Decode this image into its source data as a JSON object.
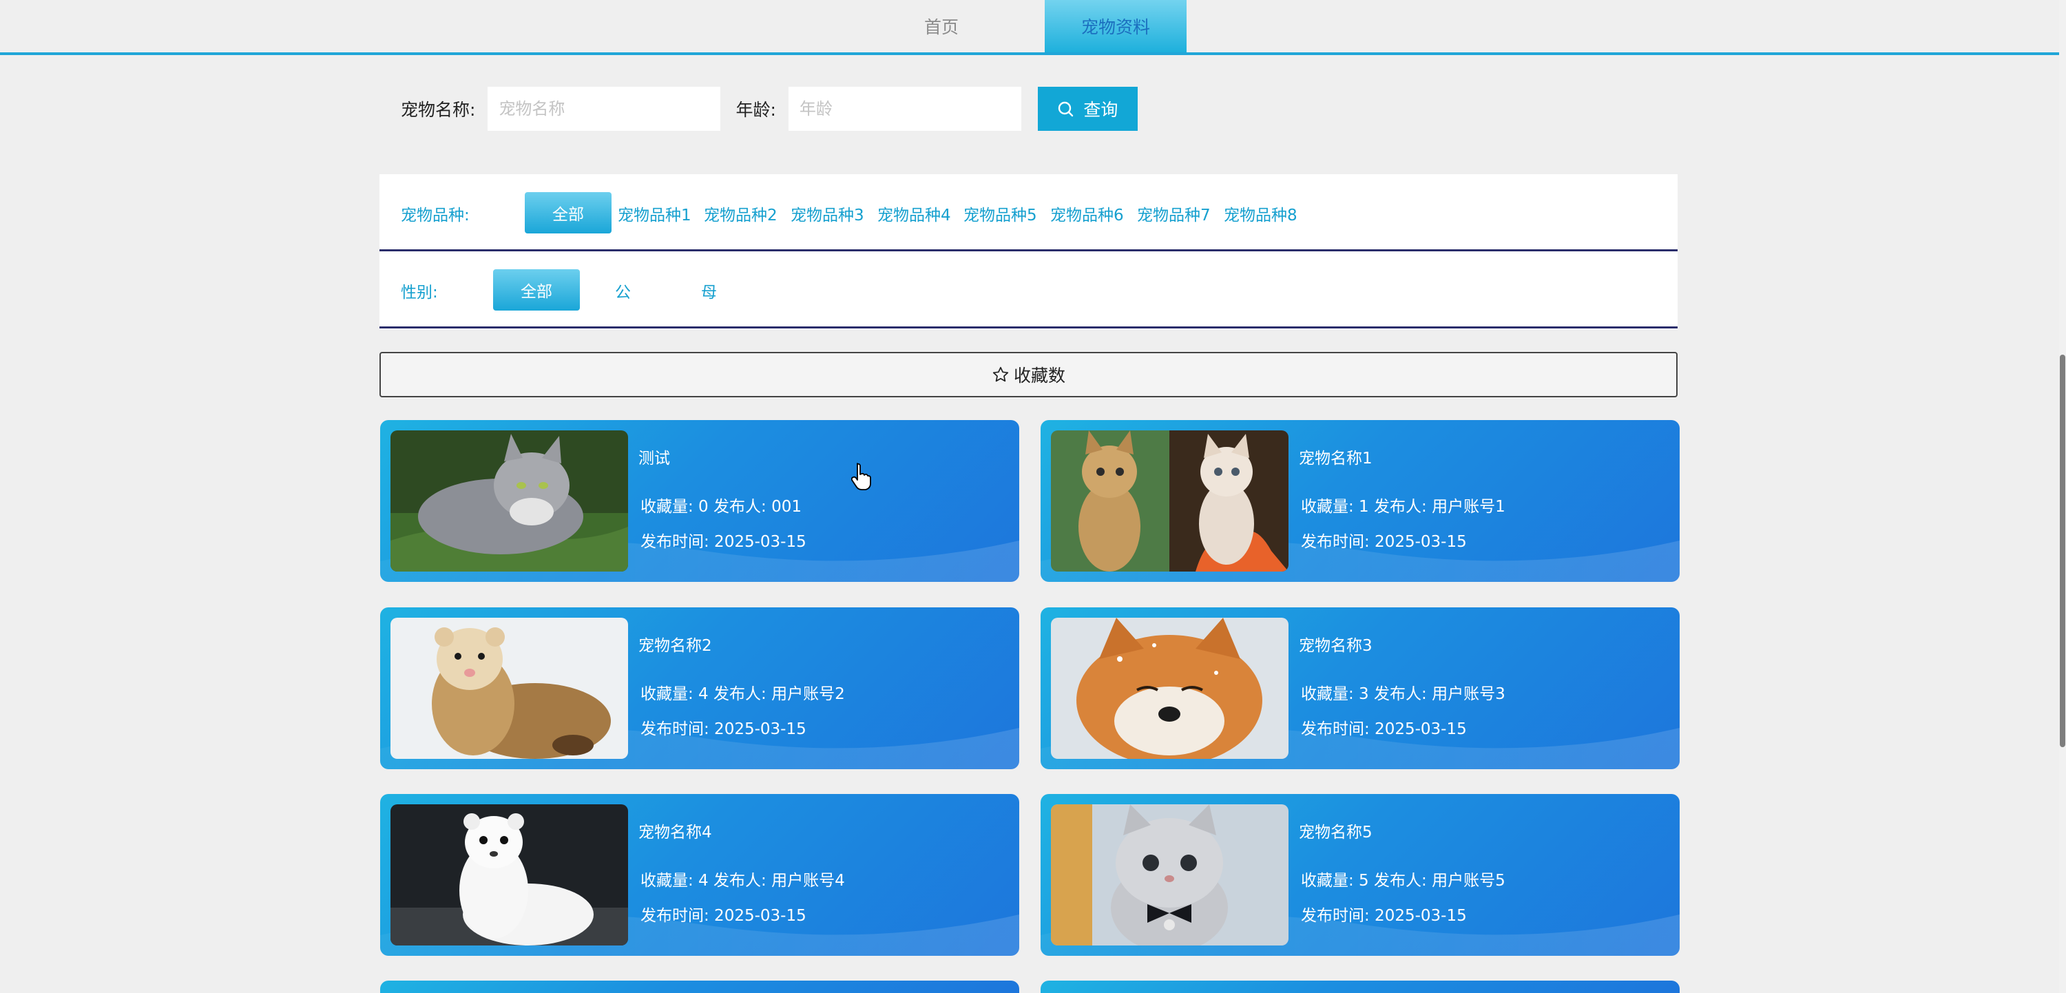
{
  "nav": {
    "tabs": [
      {
        "label": "首页"
      },
      {
        "label": "宠物资料"
      }
    ]
  },
  "search": {
    "name_label": "宠物名称:",
    "name_placeholder": "宠物名称",
    "age_label": "年龄:",
    "age_placeholder": "年龄",
    "button_label": "查询"
  },
  "filters": {
    "breed_label": "宠物品种:",
    "breeds": [
      "全部",
      "宠物品种1",
      "宠物品种2",
      "宠物品种3",
      "宠物品种4",
      "宠物品种5",
      "宠物品种6",
      "宠物品种7",
      "宠物品种8"
    ],
    "gender_label": "性别:",
    "genders": [
      "全部",
      "公",
      "母"
    ]
  },
  "sort": {
    "label": "收藏数"
  },
  "pets": [
    {
      "name": "测试",
      "stats": "收藏量:  0   发布人:  001",
      "date": "发布时间:  2025-03-15",
      "image": "grey-longhair-cat-on-grass"
    },
    {
      "name": "宠物名称1",
      "stats": "收藏量:  1   发布人:  用户账号1",
      "date": "发布时间:  2025-03-15",
      "image": "bengal-cat-and-kitten-collage"
    },
    {
      "name": "宠物名称2",
      "stats": "收藏量:  4   发布人:  用户账号2",
      "date": "发布时间:  2025-03-15",
      "image": "brown-ferret"
    },
    {
      "name": "宠物名称3",
      "stats": "收藏量:  3   发布人:  用户账号3",
      "date": "发布时间:  2025-03-15",
      "image": "shiba-inu-in-snow"
    },
    {
      "name": "宠物名称4",
      "stats": "收藏量:  4   发布人:  用户账号4",
      "date": "发布时间:  2025-03-15",
      "image": "white-ferret"
    },
    {
      "name": "宠物名称5",
      "stats": "收藏量:  5   发布人:  用户账号5",
      "date": "发布时间:  2025-03-15",
      "image": "grey-kitten-with-bowtie"
    }
  ]
}
